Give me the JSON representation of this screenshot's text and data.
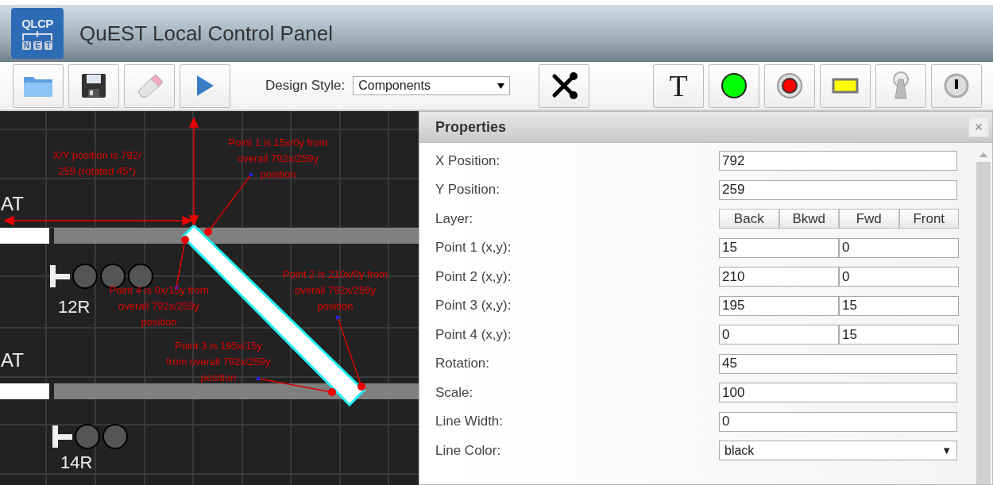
{
  "app": {
    "logo": {
      "top": "QLCP",
      "keys": [
        "N",
        "E",
        "T"
      ]
    },
    "title": "QuEST Local Control Panel"
  },
  "toolbar": {
    "left": [
      {
        "kind": "open"
      },
      {
        "kind": "save"
      },
      {
        "kind": "erase"
      },
      {
        "kind": "run"
      }
    ],
    "design_style": {
      "label": "Design Style:",
      "value": "Components"
    },
    "right": [
      {
        "kind": "tools"
      },
      {
        "kind": "text",
        "label": "T"
      },
      {
        "kind": "green-lamp"
      },
      {
        "kind": "red-button"
      },
      {
        "kind": "yellow-rect"
      },
      {
        "kind": "toggle"
      },
      {
        "kind": "knob"
      }
    ]
  },
  "canvas": {
    "track_labels": [
      "AT",
      "AT"
    ],
    "signals": [
      {
        "label": "12R",
        "lamps": [
          {
            "on": false
          },
          {
            "on": false
          },
          {
            "on": false
          }
        ]
      },
      {
        "label": "14R",
        "lamps": [
          {
            "on": false
          },
          {
            "on": false
          }
        ]
      }
    ],
    "annotations": [
      {
        "lines": [
          "X/Y position is 792/",
          "259 (rotated 45*)"
        ]
      },
      {
        "lines": [
          "Point 1 is 15x/0y from",
          "overall 792x/259y",
          "position"
        ]
      },
      {
        "lines": [
          "Point 2 is 210x/0y from",
          "overall 792x/259y",
          "position"
        ]
      },
      {
        "lines": [
          "Point 4 is 0x/15y from",
          "overall 792x/259y",
          "position"
        ]
      },
      {
        "lines": [
          "Point 3 is 195x/15y",
          "from overall 792x/259y",
          "position"
        ]
      }
    ]
  },
  "properties": {
    "title": "Properties",
    "close": "×",
    "rows": [
      {
        "kind": "text",
        "label": "X Position:",
        "value": "792"
      },
      {
        "kind": "text",
        "label": "Y Position:",
        "value": "259"
      },
      {
        "kind": "buttons",
        "label": "Layer:",
        "buttons": [
          "Back",
          "Bkwd",
          "Fwd",
          "Front"
        ]
      },
      {
        "kind": "pair",
        "label": "Point 1 (x,y):",
        "values": [
          "15",
          "0"
        ]
      },
      {
        "kind": "pair",
        "label": "Point 2 (x,y):",
        "values": [
          "210",
          "0"
        ]
      },
      {
        "kind": "pair",
        "label": "Point 3 (x,y):",
        "values": [
          "195",
          "15"
        ]
      },
      {
        "kind": "pair",
        "label": "Point 4 (x,y):",
        "values": [
          "0",
          "15"
        ]
      },
      {
        "kind": "text",
        "label": "Rotation:",
        "value": "45"
      },
      {
        "kind": "text",
        "label": "Scale:",
        "value": "100"
      },
      {
        "kind": "text",
        "label": "Line Width:",
        "value": "0"
      },
      {
        "kind": "select",
        "label": "Line Color:",
        "value": "black",
        "caret": "▼"
      }
    ]
  }
}
